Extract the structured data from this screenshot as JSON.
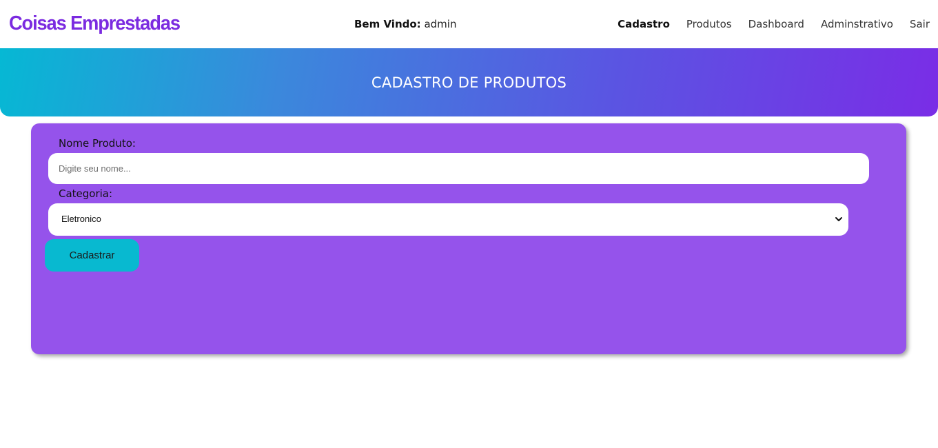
{
  "header": {
    "brand": "Coisas Emprestadas",
    "welcome_label": "Bem Vindo:",
    "welcome_user": "admin",
    "nav": [
      {
        "label": "Cadastro",
        "active": true
      },
      {
        "label": "Produtos",
        "active": false
      },
      {
        "label": "Dashboard",
        "active": false
      },
      {
        "label": "Adminstrativo",
        "active": false
      },
      {
        "label": "Sair",
        "active": false
      }
    ]
  },
  "banner": {
    "title": "CADASTRO DE PRODUTOS"
  },
  "form": {
    "nome_label": "Nome Produto:",
    "nome_placeholder": "Digite seu nome...",
    "nome_value": "",
    "categoria_label": "Categoria:",
    "categoria_selected": "Eletronico",
    "submit_label": "Cadastrar"
  },
  "icons": {
    "select_arrow": "chevron-down-icon"
  },
  "colors": {
    "brand": "#7b2be0",
    "card": "#9553eb",
    "button": "#08b9d0",
    "gradient_start": "#06b8d4",
    "gradient_end": "#7a2de6"
  }
}
